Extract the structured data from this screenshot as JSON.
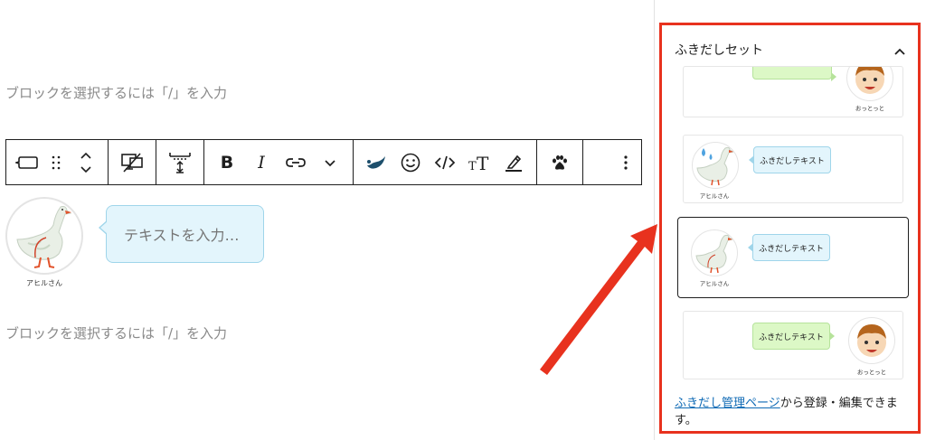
{
  "editor": {
    "placeholder_top": "ブロックを選択するには「/」を入力",
    "placeholder_bottom": "ブロックを選択するには「/」を入力",
    "balloon": {
      "avatar_name": "アヒルさん",
      "text_placeholder": "テキストを入力…"
    }
  },
  "toolbar": {
    "bold_label": "B",
    "italic_label": "I",
    "text_size_label": "TT",
    "icons": [
      "balloon-block-icon",
      "drag-handle-icon",
      "move-up-down-icon",
      "device-visibility-icon",
      "spacing-icon",
      "bold-icon",
      "italic-icon",
      "link-icon",
      "more-rich-text-icon",
      "marker-icon",
      "emoji-icon",
      "code-icon",
      "font-size-icon",
      "highlight-icon",
      "paw-icon",
      "options-icon"
    ]
  },
  "panel": {
    "title": "ふきだしセット",
    "presets": [
      {
        "bubble_text": "",
        "name": "おっとっと",
        "bubble_color": "green",
        "avatar_side": "right"
      },
      {
        "bubble_text": "ふきだしテキスト",
        "name": "アヒルさん",
        "bubble_color": "blue",
        "avatar_side": "left"
      },
      {
        "bubble_text": "ふきだしテキスト",
        "name": "アヒルさん",
        "bubble_color": "blue",
        "avatar_side": "left",
        "selected": true
      },
      {
        "bubble_text": "ふきだしテキスト",
        "name": "おっとっと",
        "bubble_color": "green",
        "avatar_side": "right"
      }
    ],
    "footer_link": "ふきだし管理ページ",
    "footer_text": "から登録・編集できます。"
  },
  "colors": {
    "highlight_border": "#e8321e",
    "arrow": "#e8321e",
    "bubble_blue": "#e3f5fc",
    "bubble_green": "#dcf8c6",
    "link": "#0f6ab5"
  }
}
